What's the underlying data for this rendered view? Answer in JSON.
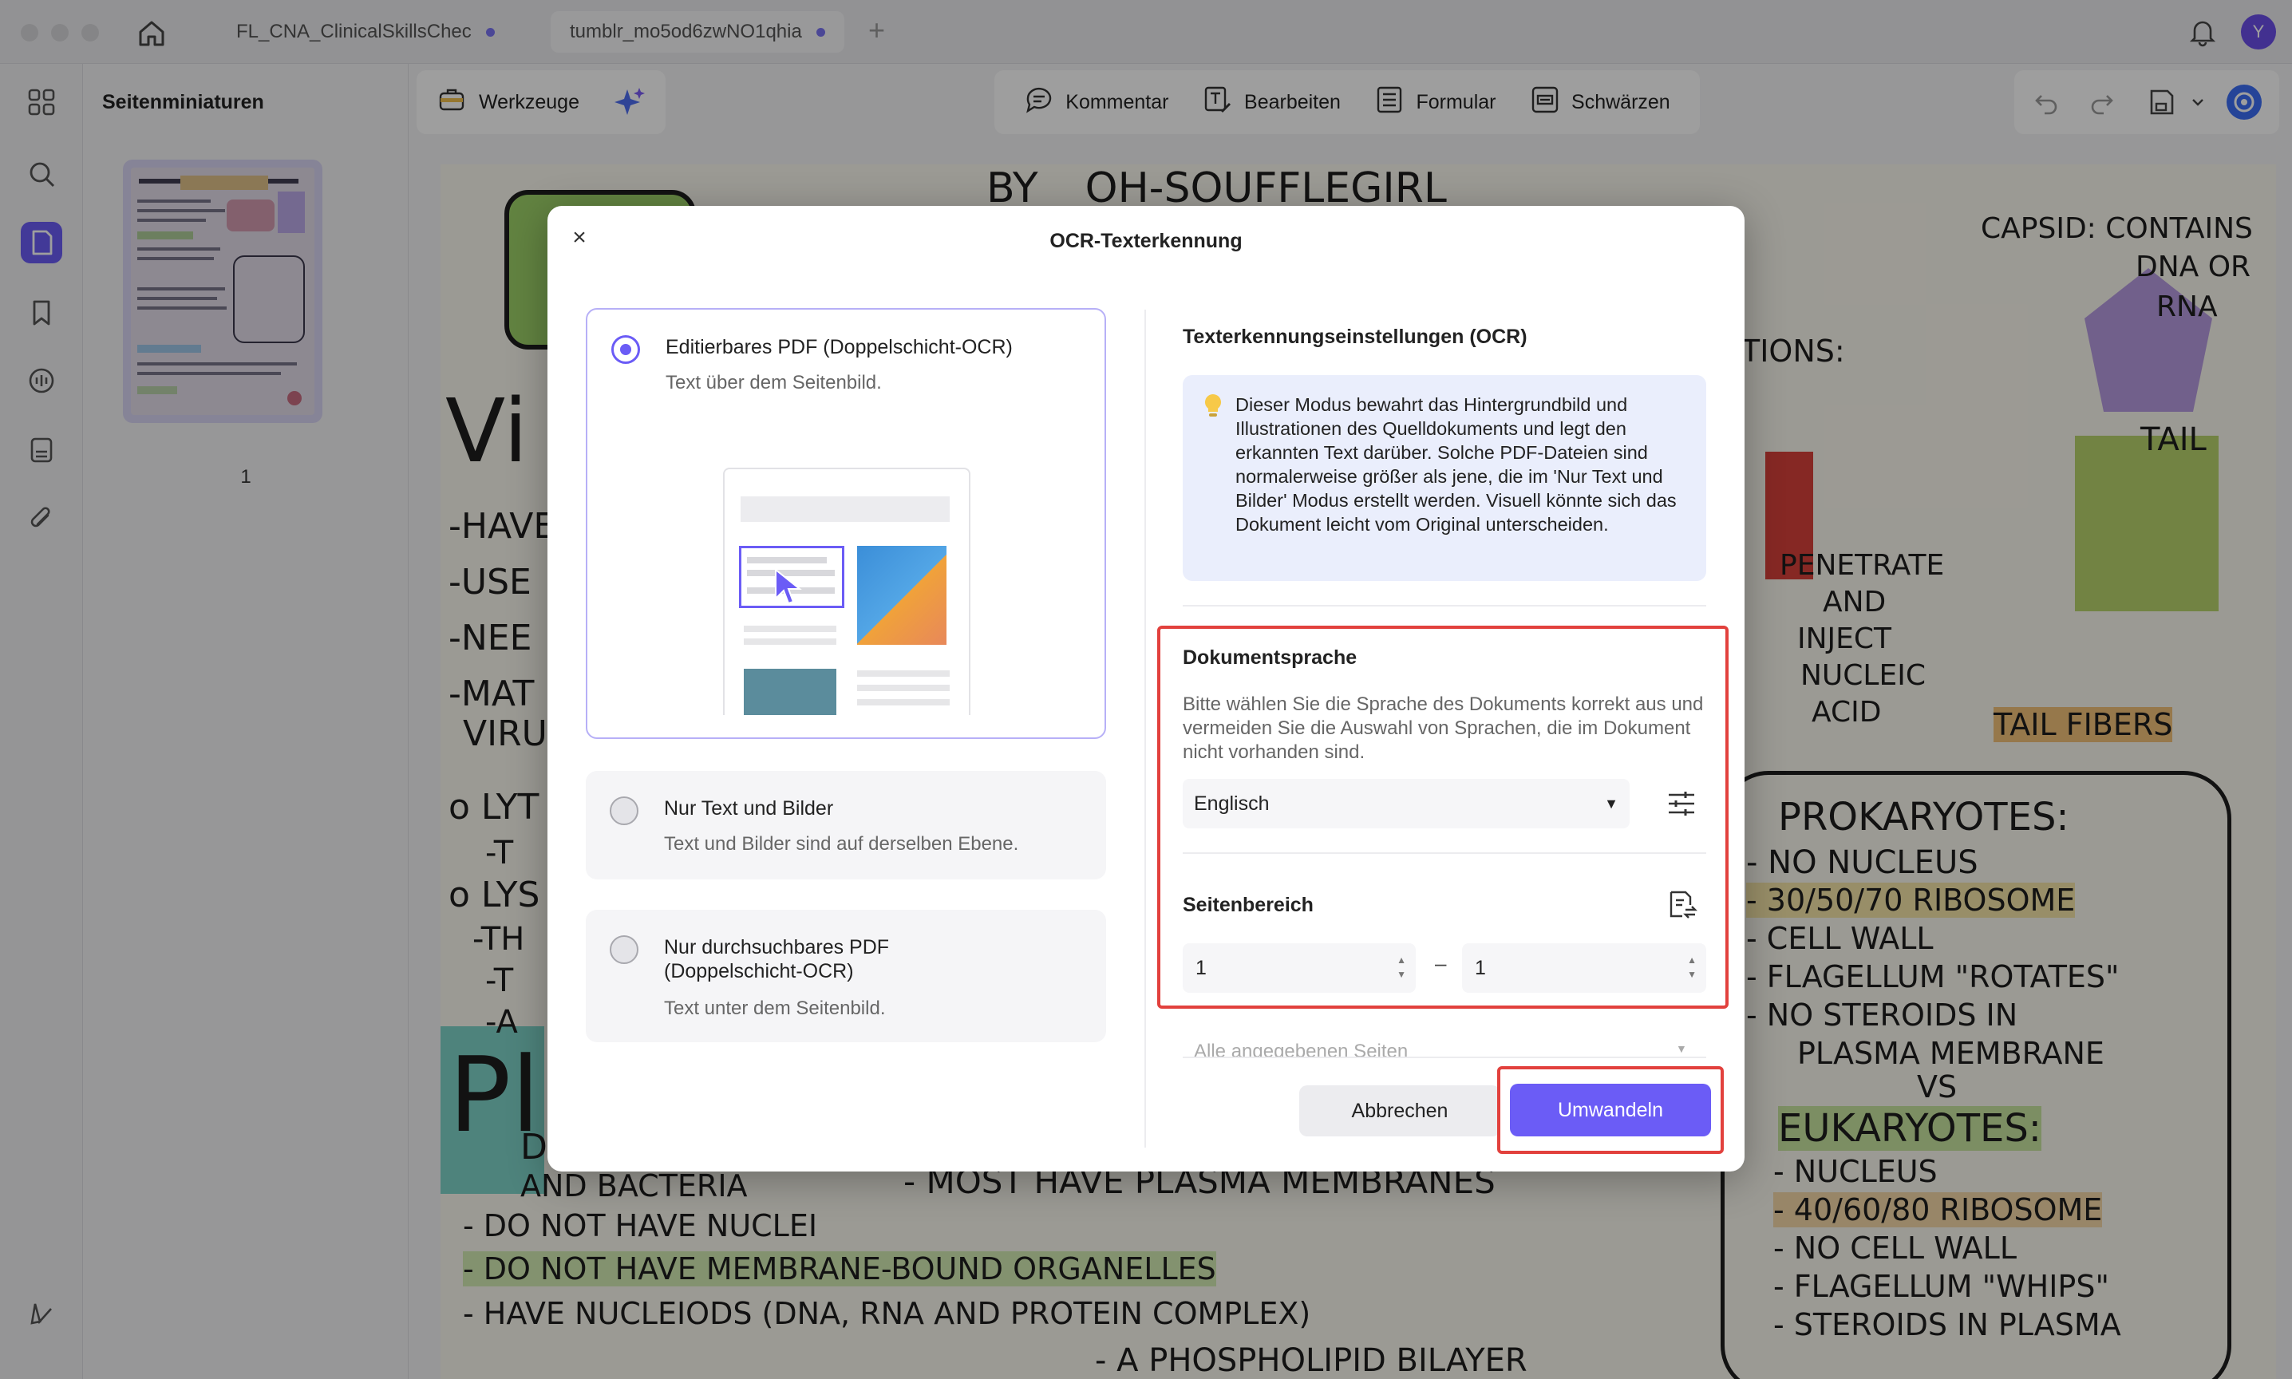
{
  "tabs": [
    {
      "label": "FL_CNA_ClinicalSkillsChec"
    },
    {
      "label": "tumblr_mo5od6zwNO1qhia"
    }
  ],
  "user": {
    "initial": "Y"
  },
  "thumbnails": {
    "title": "Seitenminiaturen",
    "page_number": "1"
  },
  "toolbar": {
    "tools_label": "Werkzeuge",
    "comment_label": "Kommentar",
    "edit_label": "Bearbeiten",
    "form_label": "Formular",
    "redact_label": "Schwärzen"
  },
  "document": {
    "lines": [
      "BY _ OH-SOUFFLEGIRL",
      "CAPSID: CONTAINS",
      "DNA OR",
      "RNA",
      "TAIL",
      "TIONS:",
      "PENETRATE",
      "AND",
      "INJECT",
      "NUCLEIC",
      "ACID",
      "TAIL FIBERS",
      "PROKARYOTES:",
      "- NO NUCLEUS",
      "- 30/50/70 RIBOSOME",
      "- CELL WALL",
      "- FLAGELLUM \"ROTATES\"",
      "- NO STEROIDS IN",
      "PLASMA MEMBRANE",
      "VS",
      "EUKARYOTES:",
      "- NUCLEUS",
      "- 40/60/80 RIBOSOME",
      "- NO CELL WALL",
      "- FLAGELLUM \"WHIPS\"",
      "- STEROIDS IN PLASMA",
      "Vi",
      "-HAVE",
      "-USE",
      "-NEE",
      "-MAT",
      "VIRU",
      "o LYT",
      "-T",
      "o LYS",
      "-TH",
      "-T",
      "-A",
      "Pl",
      "D",
      "AND BACTERIA",
      "- MOST HAVE PLASMA MEMBRANES",
      "- DO NOT HAVE NUCLEI",
      "- DO NOT HAVE MEMBRANE-BOUND ORGANELLES",
      "- HAVE NUCLEIODS (DNA, RNA AND PROTEIN COMPLEX)",
      "- A PHOSPHOLIPID BILAYER"
    ]
  },
  "dialog": {
    "title": "OCR-Texterkennung",
    "options": [
      {
        "title": "Editierbares PDF (Doppelschicht-OCR)",
        "desc": "Text über dem Seitenbild."
      },
      {
        "title": "Nur Text und Bilder",
        "desc": "Text und Bilder sind auf derselben Ebene."
      },
      {
        "title": "Nur durchsuchbares PDF\n(Doppelschicht-OCR)",
        "desc": "Text unter dem Seitenbild."
      }
    ],
    "settings_title": "Texterkennungseinstellungen (OCR)",
    "info_text": "Dieser Modus bewahrt das Hintergrundbild und Illustrationen des Quelldokuments und legt den erkannten Text darüber. Solche PDF-Dateien sind normalerweise größer als jene, die im 'Nur Text und Bilder' Modus erstellt werden. Visuell könnte sich das Dokument leicht vom Original unterscheiden.",
    "language_title": "Dokumentsprache",
    "language_help": "Bitte wählen Sie die Sprache des Dokuments korrekt aus und vermeiden Sie die Auswahl von Sprachen, die im Dokument nicht vorhanden sind.",
    "language_value": "Englisch",
    "range_title": "Seitenbereich",
    "range_from": "1",
    "range_to": "1",
    "range_sep": "–",
    "page_filter": "Alle angegebenen Seiten",
    "cancel_label": "Abbrechen",
    "convert_label": "Umwandeln"
  },
  "colors": {
    "accent": "#6b5cf6",
    "highlight": "#e2413d"
  }
}
